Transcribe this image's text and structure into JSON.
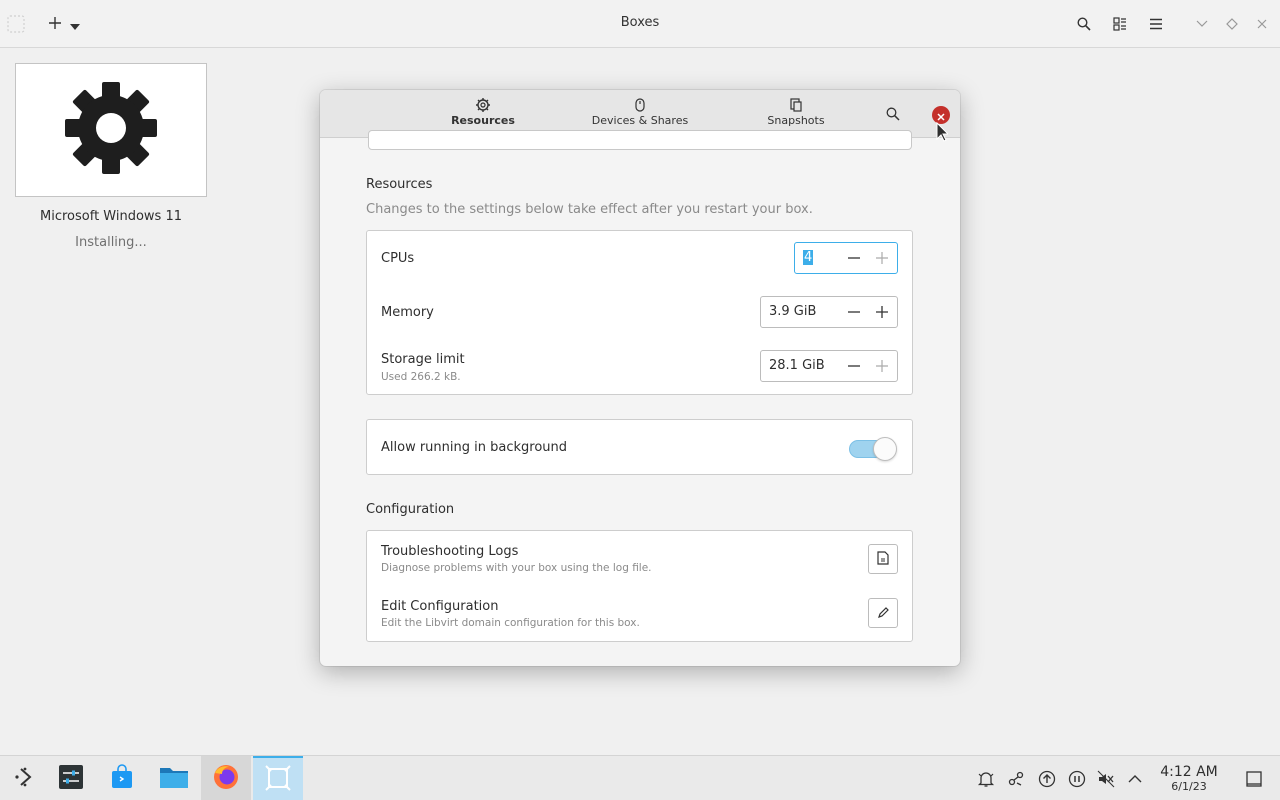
{
  "header": {
    "title": "Boxes"
  },
  "boxes": [
    {
      "name": "Microsoft Windows 11",
      "status": "Installing..."
    }
  ],
  "dialog": {
    "tabs": [
      {
        "label": "Resources",
        "icon": "gear-icon",
        "active": true
      },
      {
        "label": "Devices & Shares",
        "icon": "mouse-icon",
        "active": false
      },
      {
        "label": "Snapshots",
        "icon": "snapshots-icon",
        "active": false
      }
    ],
    "resources": {
      "title": "Resources",
      "subtitle": "Changes to the settings below take effect after you restart your box.",
      "cpus": {
        "label": "CPUs",
        "value": "4"
      },
      "memory": {
        "label": "Memory",
        "value": "3.9 GiB"
      },
      "storage": {
        "label": "Storage limit",
        "sublabel": "Used 266.2 kB.",
        "value": "28.1 GiB"
      }
    },
    "background": {
      "label": "Allow running in background",
      "enabled": true
    },
    "configuration": {
      "title": "Configuration",
      "logs": {
        "label": "Troubleshooting Logs",
        "sublabel": "Diagnose problems with your box using the log file."
      },
      "edit": {
        "label": "Edit Configuration",
        "sublabel": "Edit the Libvirt domain configuration for this box."
      }
    }
  },
  "taskbar": {
    "time": "4:12 AM",
    "date": "6/1/23"
  },
  "colors": {
    "accent": "#3daee9",
    "close_red": "#c4302b",
    "toggle_on": "#9fd3ef"
  }
}
